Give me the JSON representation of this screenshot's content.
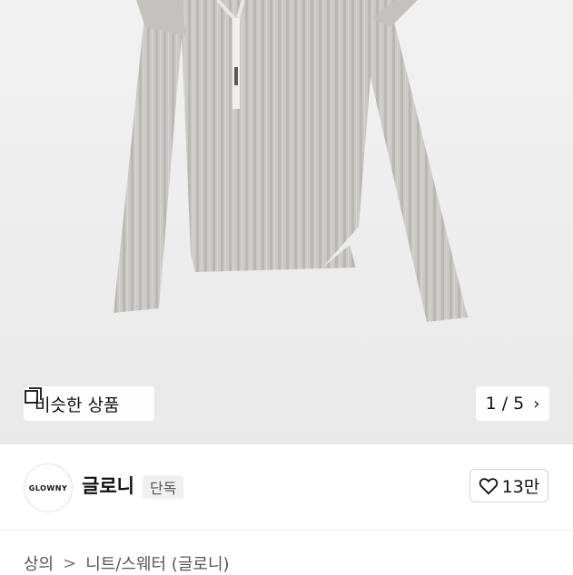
{
  "gallery": {
    "similar_label": "비슷한 상품",
    "similar_icon": "similar-items-icon",
    "counter": "1 / 5",
    "next_icon": "chevron-right-icon",
    "garment_color": "#c9c8c4"
  },
  "brand": {
    "logo_text": "GLOWNY",
    "name": "글로니",
    "badge": "단독",
    "like_count": "13만",
    "like_icon": "heart-outline-icon"
  },
  "breadcrumb": {
    "items": [
      "상의",
      "니트/스웨터 (글로니)"
    ],
    "separator": ">"
  }
}
